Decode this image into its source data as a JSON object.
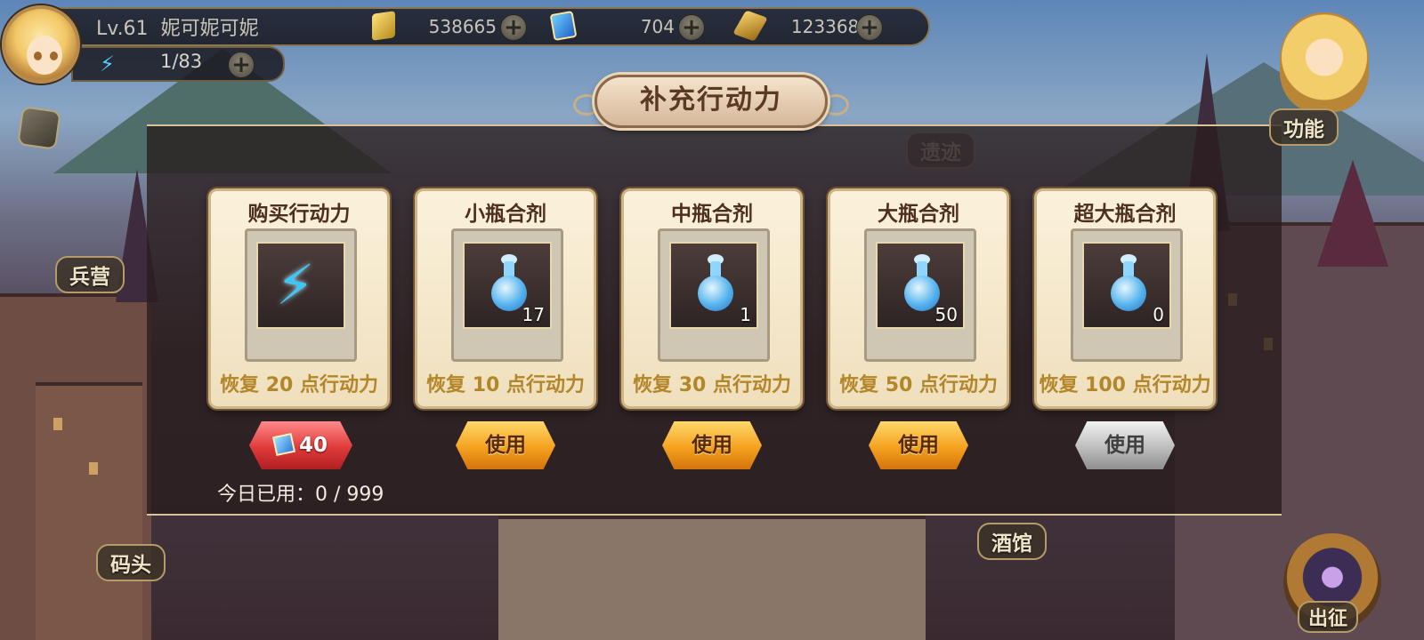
{
  "player": {
    "level": "Lv.61",
    "name": "妮可妮可妮",
    "energy": "1/83"
  },
  "resources": [
    {
      "icon": "gold-ingot-icon",
      "value": "538665"
    },
    {
      "icon": "diamond-card-icon",
      "value": "704"
    },
    {
      "icon": "gold-coin-icon",
      "value": "1233688"
    }
  ],
  "side": {
    "function": "功能",
    "barracks": "兵营",
    "dock": "码头",
    "tavern": "酒馆",
    "ruins": "遗迹",
    "sally": "出征"
  },
  "dialog": {
    "title": "补充行动力",
    "cards": [
      {
        "name": "购买行动力",
        "icon": "lightning-bolt-icon",
        "count": "",
        "desc": "恢复 20 点行动力"
      },
      {
        "name": "小瓶合剂",
        "icon": "small-potion-icon",
        "count": "17",
        "desc": "恢复 10 点行动力"
      },
      {
        "name": "中瓶合剂",
        "icon": "medium-potion-icon",
        "count": "1",
        "desc": "恢复 30 点行动力"
      },
      {
        "name": "大瓶合剂",
        "icon": "large-potion-icon",
        "count": "50",
        "desc": "恢复 50 点行动力"
      },
      {
        "name": "超大瓶合剂",
        "icon": "extra-large-potion-icon",
        "count": "0",
        "desc": "恢复 100 点行动力"
      }
    ],
    "buy_price": "40",
    "use_label": "使用",
    "usage_text": "今日已用：0 / 999"
  },
  "colors": {
    "accent_gold": "#b3862a",
    "use_button": "#f5a21f",
    "buy_button": "#e03a3a",
    "disabled_button": "#bdbdbd"
  }
}
